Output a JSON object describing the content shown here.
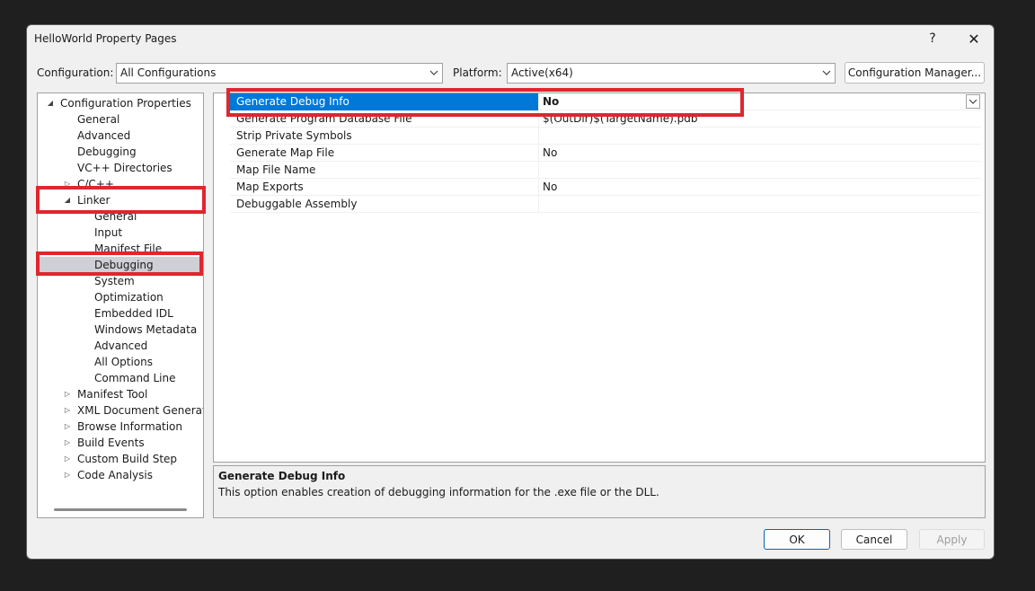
{
  "window": {
    "title": "HelloWorld Property Pages",
    "help_glyph": "?",
    "close_glyph": "✕"
  },
  "config_bar": {
    "configuration_label": "Configuration:",
    "configuration_value": "All Configurations",
    "platform_label": "Platform:",
    "platform_value": "Active(x64)",
    "manager_button": "Configuration Manager..."
  },
  "tree": {
    "items": [
      {
        "label": "Configuration Properties",
        "arrow": "◢"
      },
      {
        "label": "General",
        "arrow": ""
      },
      {
        "label": "Advanced",
        "arrow": ""
      },
      {
        "label": "Debugging",
        "arrow": ""
      },
      {
        "label": "VC++ Directories",
        "arrow": ""
      },
      {
        "label": "C/C++",
        "arrow": "▷"
      },
      {
        "label": "Linker",
        "arrow": "◢"
      },
      {
        "label": "General",
        "arrow": ""
      },
      {
        "label": "Input",
        "arrow": ""
      },
      {
        "label": "Manifest File",
        "arrow": ""
      },
      {
        "label": "Debugging",
        "arrow": ""
      },
      {
        "label": "System",
        "arrow": ""
      },
      {
        "label": "Optimization",
        "arrow": ""
      },
      {
        "label": "Embedded IDL",
        "arrow": ""
      },
      {
        "label": "Windows Metadata",
        "arrow": ""
      },
      {
        "label": "Advanced",
        "arrow": ""
      },
      {
        "label": "All Options",
        "arrow": ""
      },
      {
        "label": "Command Line",
        "arrow": ""
      },
      {
        "label": "Manifest Tool",
        "arrow": "▷"
      },
      {
        "label": "XML Document Generator",
        "arrow": "▷"
      },
      {
        "label": "Browse Information",
        "arrow": "▷"
      },
      {
        "label": "Build Events",
        "arrow": "▷"
      },
      {
        "label": "Custom Build Step",
        "arrow": "▷"
      },
      {
        "label": "Code Analysis",
        "arrow": "▷"
      }
    ]
  },
  "properties": {
    "rows": [
      {
        "name": "Generate Debug Info",
        "value": "No"
      },
      {
        "name": "Generate Program Database File",
        "value": "$(OutDir)$(TargetName).pdb"
      },
      {
        "name": "Strip Private Symbols",
        "value": ""
      },
      {
        "name": "Generate Map File",
        "value": "No"
      },
      {
        "name": "Map File Name",
        "value": ""
      },
      {
        "name": "Map Exports",
        "value": "No"
      },
      {
        "name": "Debuggable Assembly",
        "value": ""
      }
    ]
  },
  "description": {
    "title": "Generate Debug Info",
    "text": "This option enables creation of debugging information for the .exe file or the DLL."
  },
  "buttons": {
    "ok": "OK",
    "cancel": "Cancel",
    "apply": "Apply"
  },
  "colors": {
    "selection_blue": "#0078d7",
    "highlight_red": "#e0262e",
    "tree_selected": "#cfcfd6"
  }
}
